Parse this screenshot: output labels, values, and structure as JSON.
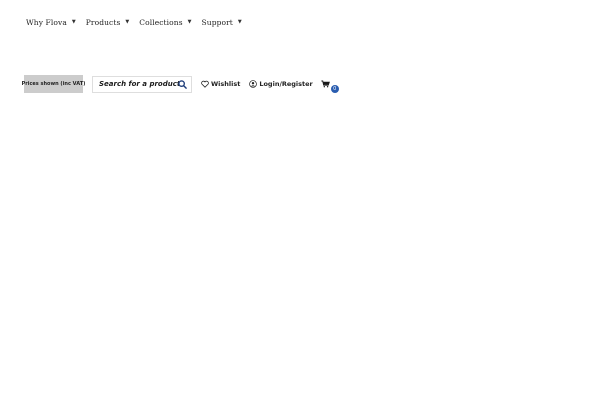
{
  "nav": {
    "items": [
      {
        "label": "Why Flova"
      },
      {
        "label": "Products"
      },
      {
        "label": "Collections"
      },
      {
        "label": "Support"
      }
    ]
  },
  "toolbar": {
    "vat_label": "Prices shown (inc VAT)",
    "search_placeholder": "Search for a product...",
    "wishlist_label": "Wishlist",
    "login_label": "Login/Register",
    "cart_count": "0"
  },
  "colors": {
    "badge_bg": "#cccccc",
    "cart_badge": "#2a5db0",
    "text": "#1a1a1a"
  },
  "icons": [
    "chevron-down-icon",
    "search-icon",
    "heart-icon",
    "user-icon",
    "cart-icon"
  ]
}
